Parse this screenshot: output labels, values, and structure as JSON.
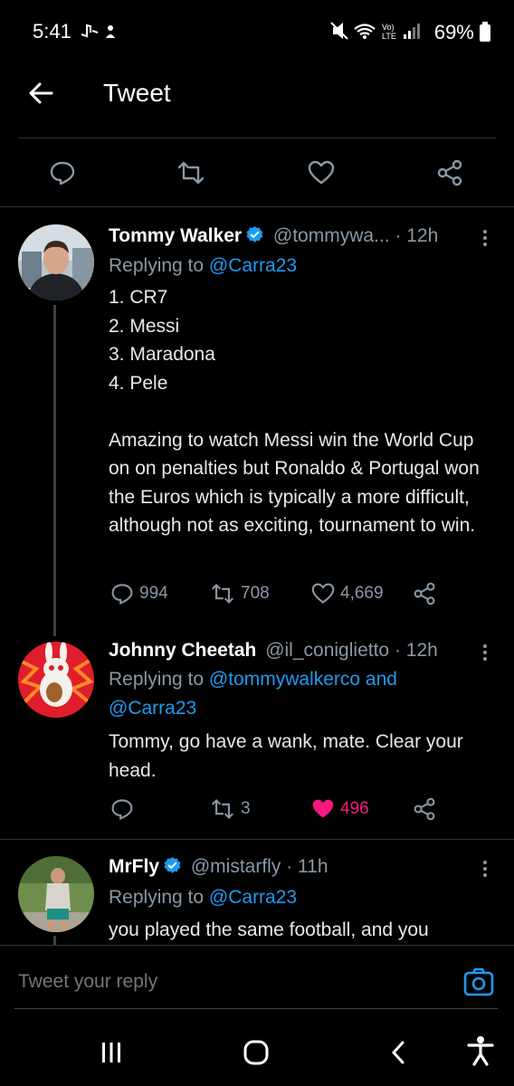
{
  "status_bar": {
    "time": "5:41",
    "battery": "69%"
  },
  "header": {
    "title": "Tweet"
  },
  "tweets": [
    {
      "name": "Tommy Walker",
      "verified": true,
      "handle": "@tommywa...",
      "time": "· 12h",
      "replying_prefix": "Replying to ",
      "replying_to": "@Carra23",
      "body": "1. CR7\n2. Messi\n3. Maradona\n4. Pele\n\nAmazing to watch Messi win the World Cup on on penalties but Ronaldo & Portugal won the Euros which is typically a more difficult, although not as exciting, tournament to win.",
      "replies": "994",
      "retweets": "708",
      "likes": "4,669"
    },
    {
      "name": "Johnny Cheetah",
      "verified": false,
      "handle": "@il_coniglietto",
      "time": "· 12h",
      "replying_prefix": "Replying to ",
      "replying_to": "@tommywalkerco and",
      "replying_to_2": "@Carra23",
      "body": "Tommy, go have a wank, mate. Clear your head.",
      "replies": "",
      "retweets": "3",
      "likes": "496",
      "liked": true
    },
    {
      "name": "MrFly",
      "verified": true,
      "handle": "@mistarfly",
      "time": "· 11h",
      "replying_prefix": "Replying to ",
      "replying_to": "@Carra23",
      "body": "you played the same football, and you"
    }
  ],
  "reply_box": {
    "placeholder": "Tweet your reply"
  },
  "colors": {
    "background": "#000000",
    "accent": "#1d9bf0",
    "like": "#f91880",
    "muted": "#8b98a5"
  }
}
